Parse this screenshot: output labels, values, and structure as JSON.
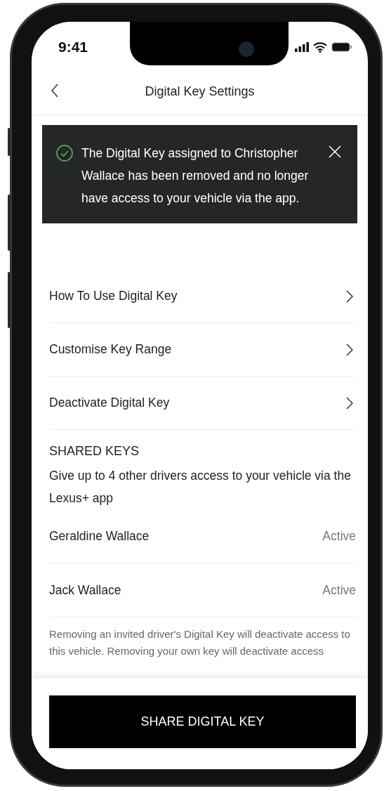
{
  "status_bar": {
    "time": "9:41"
  },
  "header": {
    "title": "Digital Key Settings"
  },
  "toast": {
    "kind": "success",
    "message": "The Digital Key assigned to Christopher Wallace has been removed and no longer have access to your vehicle via the app."
  },
  "menu": [
    {
      "label": "How To Use Digital Key"
    },
    {
      "label": "Customise Key Range"
    },
    {
      "label": "Deactivate Digital Key"
    }
  ],
  "shared_keys": {
    "heading": "SHARED KEYS",
    "description": "Give up to 4 other drivers access to your vehicle via the Lexus+ app",
    "drivers": [
      {
        "name": "Geraldine Wallace",
        "status": "Active"
      },
      {
        "name": "Jack Wallace",
        "status": "Active"
      }
    ],
    "note": "Removing an invited driver's Digital Key will deactivate access to this vehicle. Removing your own key will deactivate access"
  },
  "primary_button": "SHARE DIGITAL KEY"
}
